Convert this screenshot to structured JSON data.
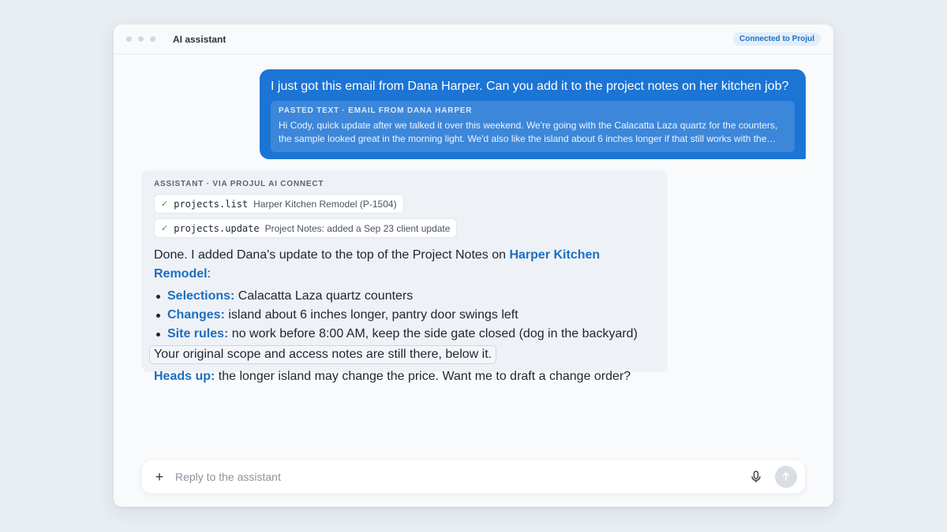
{
  "window": {
    "title": "AI assistant",
    "connection_badge": "Connected to Projul"
  },
  "user_message": {
    "text": "I just got this email from Dana Harper. Can you add it to the project notes on her kitchen job?",
    "pasted_label": "PASTED TEXT · EMAIL FROM DANA HARPER",
    "pasted_line1": "Hi Cody, quick update after we talked it over this weekend. We're going with the Calacatta Laza quartz for the counters,",
    "pasted_line2": "the sample looked great in the morning light. We'd also like the island about 6 inches longer if that still works with the…"
  },
  "assistant_message": {
    "label": "ASSISTANT · VIA PROJUL AI CONNECT",
    "tools": [
      {
        "name": "projects.list",
        "detail": "Harper Kitchen Remodel (P-1504)"
      },
      {
        "name": "projects.update",
        "detail": "Project Notes: added a Sep 23 client update"
      }
    ],
    "intro_before": "Done. I added Dana's update to the top of the Project Notes on ",
    "intro_link": "Harper Kitchen Remodel",
    "intro_after": ":",
    "bullets": [
      {
        "key": "Selections:",
        "text": " Calacatta Laza quartz counters"
      },
      {
        "key": "Changes:",
        "text": " island about 6 inches longer, pantry door swings left"
      },
      {
        "key": "Site rules:",
        "text": " no work before 8:00 AM, keep the side gate closed (dog in the backyard)"
      }
    ],
    "note": "Your original scope and access notes are still there, below it.",
    "heads_up_key": "Heads up:",
    "heads_up_text": " the longer island may change the price. Want me to draft a change order?"
  },
  "composer": {
    "placeholder": "Reply to the assistant",
    "plus_glyph": "+",
    "send_glyph": "↑"
  },
  "colors": {
    "user_bubble": "#1c74d4",
    "accent_link": "#1c6fc0",
    "check": "#2f9d5a"
  }
}
